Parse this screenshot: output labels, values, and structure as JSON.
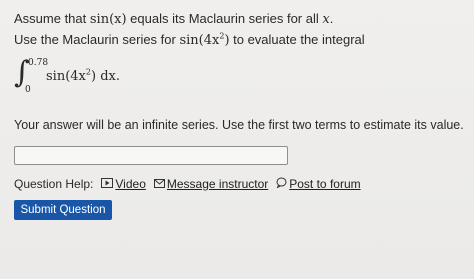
{
  "question": {
    "line1_a": "Assume that ",
    "line1_func": "sin(x)",
    "line1_b": " equals its Maclaurin series for all ",
    "line1_var": "x",
    "line1_end": ".",
    "line2_a": "Use the Maclaurin series for ",
    "line2_func_pre": "sin(4x",
    "line2_func_exp": "2",
    "line2_func_post": ")",
    "line2_b": " to evaluate the integral",
    "integral": {
      "upper": "0.78",
      "lower": "0",
      "integrand_pre": "sin(4x",
      "integrand_exp": "2",
      "integrand_post": ") dx."
    },
    "instructions": "Your answer will be an infinite series. Use the first two terms to estimate its value."
  },
  "answer_input": {
    "value": "",
    "placeholder": ""
  },
  "help": {
    "label": "Question Help:",
    "video_label": "Video",
    "video_icon": "play-icon",
    "message_label": "Message instructor",
    "message_icon": "envelope-icon",
    "forum_label": "Post to forum",
    "forum_icon": "speech-bubble-icon"
  },
  "submit": {
    "label": "Submit Question",
    "color": "#1a56a8"
  }
}
